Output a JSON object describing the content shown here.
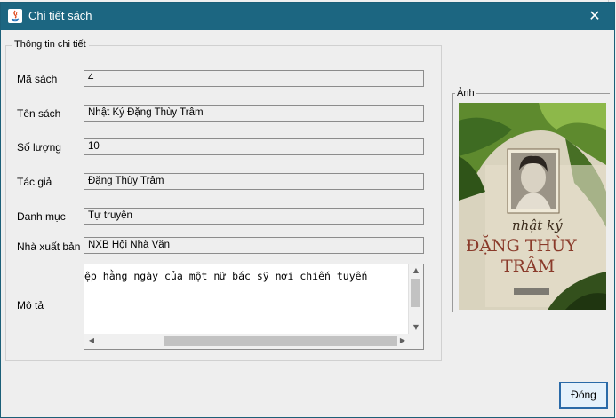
{
  "window": {
    "title": "Chi tiết sách",
    "close_glyph": "✕"
  },
  "group": {
    "title": "Thông tin chi tiết"
  },
  "fields": [
    {
      "label": "Mã sách",
      "value": "4"
    },
    {
      "label": "Tên sách",
      "value": "Nhật Ký Đặng Thùy Trâm"
    },
    {
      "label": "Số lượng",
      "value": "10"
    },
    {
      "label": "Tác giả",
      "value": "Đặng Thùy Trâm"
    },
    {
      "label": "Danh mục",
      "value": "Tự truyện"
    },
    {
      "label": "Nhà xuất bản",
      "value": "NXB Hội Nhà Văn"
    }
  ],
  "description": {
    "label": "Mô tả",
    "value": "ệp hằng ngày của một nữ bác sỹ nơi chiến tuyến"
  },
  "image": {
    "title": "Ảnh",
    "cover_line1": "nhật ký",
    "cover_line2": "ĐẶNG THÙY",
    "cover_line3": "TRÂM"
  },
  "buttons": {
    "close": "Đóng"
  },
  "colors": {
    "titlebar": "#1c6681",
    "accent": "#2a6aa8"
  }
}
